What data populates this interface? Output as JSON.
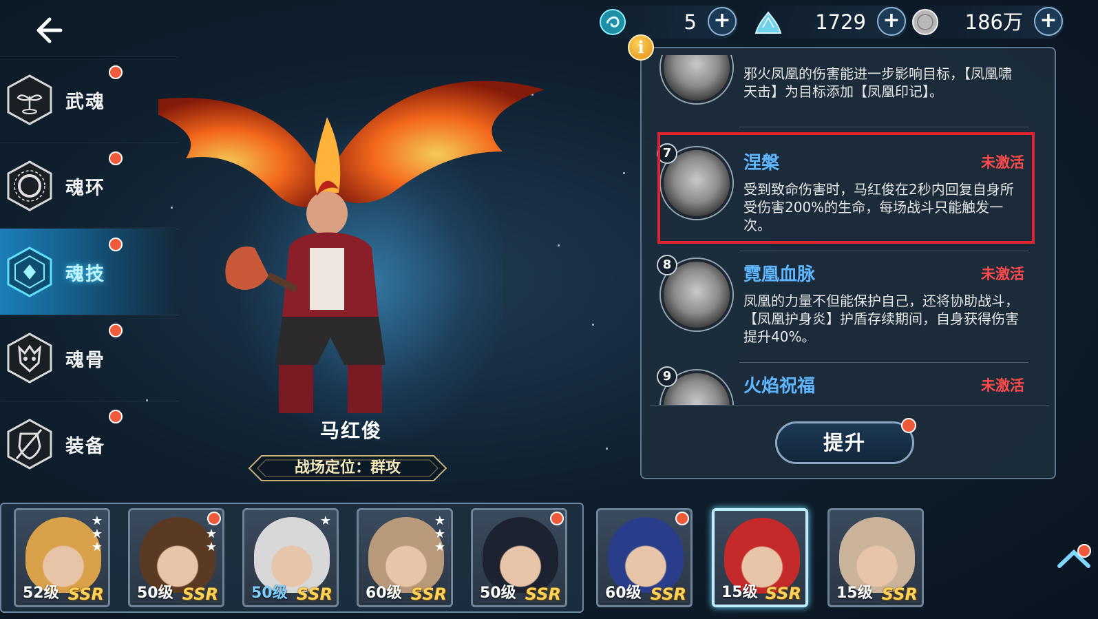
{
  "header": {
    "back_icon": "arrow-left-icon",
    "currencies": [
      {
        "icon": "soul-orb-icon",
        "value": "5",
        "color": "#4ad6e8"
      },
      {
        "icon": "crystal-pile-icon",
        "value": "1729",
        "color": "#8ee0ef"
      },
      {
        "icon": "silver-coin-icon",
        "value": "186万",
        "color": "#c9c9c9"
      }
    ],
    "plus_label": "+"
  },
  "menu": {
    "items": [
      {
        "label": "武魂",
        "icon": "sprout-icon",
        "badge": true
      },
      {
        "label": "魂环",
        "icon": "ring-icon",
        "badge": true
      },
      {
        "label": "魂技",
        "icon": "skill-crystal-icon",
        "badge": true,
        "active": true
      },
      {
        "label": "魂骨",
        "icon": "bone-mask-icon",
        "badge": true
      },
      {
        "label": "装备",
        "icon": "shield-icon",
        "badge": true
      }
    ]
  },
  "character": {
    "name": "马红俊",
    "role": "战场定位：群攻"
  },
  "skills": {
    "info_label": "i",
    "items": [
      {
        "num": "",
        "name": "",
        "status": "",
        "desc": "邪火凤凰的伤害能进一步影响目标，【凤凰啸天击】为目标添加【凤凰印记】。"
      },
      {
        "num": "7",
        "name": "涅槃",
        "status": "未激活",
        "desc": "受到致命伤害时，马红俊在2秒内回复自身所受伤害200%的生命，每场战斗只能触发一次。"
      },
      {
        "num": "8",
        "name": "霓凰血脉",
        "status": "未激活",
        "desc": "凤凰的力量不但能保护自己，还将协助战斗，【凤凰护身炎】护盾存续期间，自身获得伤害提升40%。"
      },
      {
        "num": "9",
        "name": "火焰祝福",
        "status": "未激活",
        "desc": ""
      }
    ],
    "upgrade_label": "提升"
  },
  "team": {
    "cards": [
      {
        "level": "52级",
        "rarity": "SSR",
        "stars": 3,
        "badge": false,
        "hair": "#d9a24a"
      },
      {
        "level": "50级",
        "rarity": "SSR",
        "stars": 3,
        "badge": true,
        "hair": "#5a3a22"
      },
      {
        "level": "50级",
        "rarity": "SSR",
        "stars": 1,
        "badge": false,
        "hair": "#d8d8d8",
        "level_color": "blue"
      },
      {
        "level": "60级",
        "rarity": "SSR",
        "stars": 3,
        "badge": false,
        "hair": "#b89a7a"
      },
      {
        "level": "50级",
        "rarity": "SSR",
        "stars": 0,
        "badge": true,
        "hair": "#1c2230"
      },
      {
        "level": "60级",
        "rarity": "SSR",
        "stars": 0,
        "badge": true,
        "hair": "#2a3d8a"
      },
      {
        "level": "15级",
        "rarity": "SSR",
        "stars": 0,
        "badge": false,
        "hair": "#c42a2a",
        "selected": true
      },
      {
        "level": "15级",
        "rarity": "SSR",
        "stars": 0,
        "badge": false,
        "hair": "#c9b39a"
      }
    ],
    "expand_icon": "chevron-up-icon"
  }
}
